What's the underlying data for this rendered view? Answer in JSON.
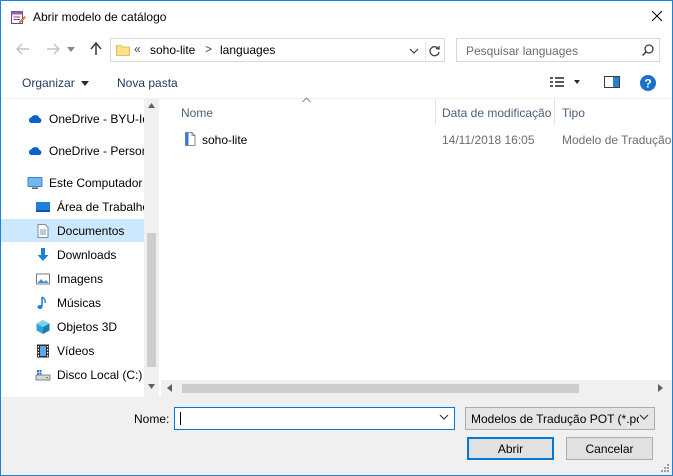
{
  "window": {
    "title": "Abrir modelo de catálogo"
  },
  "address": {
    "overflow": "«",
    "crumbs": [
      "soho-lite",
      "languages"
    ],
    "separator": ">"
  },
  "search": {
    "placeholder": "Pesquisar languages"
  },
  "toolbar": {
    "organize": "Organizar",
    "new_folder": "Nova pasta"
  },
  "sidebar": {
    "items": [
      {
        "label": "OneDrive - BYU-Idaho",
        "icon": "onedrive-cloud-icon"
      },
      {
        "label": "OneDrive - Personal",
        "icon": "onedrive-cloud-icon"
      },
      {
        "label": "Este Computador",
        "icon": "computer-icon"
      },
      {
        "label": "Área de Trabalho",
        "icon": "desktop-folder-icon"
      },
      {
        "label": "Documentos",
        "icon": "documents-folder-icon"
      },
      {
        "label": "Downloads",
        "icon": "downloads-arrow-icon"
      },
      {
        "label": "Imagens",
        "icon": "pictures-folder-icon"
      },
      {
        "label": "Músicas",
        "icon": "music-note-icon"
      },
      {
        "label": "Objetos 3D",
        "icon": "3d-objects-cube-icon"
      },
      {
        "label": "Vídeos",
        "icon": "videos-film-icon"
      },
      {
        "label": "Disco Local (C:)",
        "icon": "local-disk-icon"
      }
    ]
  },
  "columns": {
    "name": "Nome",
    "date": "Data de modificação",
    "type": "Tipo"
  },
  "files": [
    {
      "name": "soho-lite",
      "date": "14/11/2018 16:05",
      "type": "Modelo de Tradução POT"
    }
  ],
  "footer": {
    "name_label": "Nome:",
    "name_value": "",
    "filter": "Modelos de Tradução POT (*.pot)",
    "open": "Abrir",
    "cancel": "Cancelar"
  },
  "colors": {
    "accent": "#0078d7",
    "selected": "#cce8ff",
    "border": "#1883d7"
  }
}
